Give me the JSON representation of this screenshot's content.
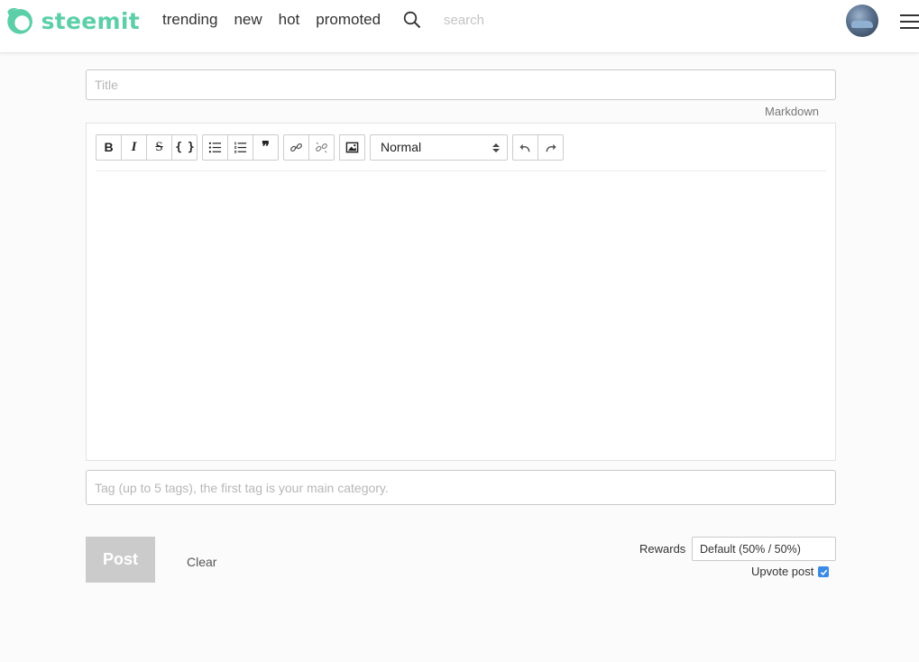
{
  "brand": {
    "name": "steemit",
    "color": "#5ccfa8"
  },
  "nav": {
    "items": [
      "trending",
      "new",
      "hot",
      "promoted"
    ]
  },
  "search": {
    "placeholder": "search"
  },
  "editor": {
    "title_placeholder": "Title",
    "markdown_link": "Markdown",
    "format_select": "Normal",
    "toolbar_icons": [
      "bold-icon",
      "italic-icon",
      "strikethrough-icon",
      "code-icon",
      "bullet-list-icon",
      "numbered-list-icon",
      "quote-icon",
      "link-icon",
      "unlink-icon",
      "image-icon",
      "undo-icon",
      "redo-icon"
    ],
    "bold_label": "B",
    "italic_label": "I",
    "strike_label": "S",
    "code_label": "{ }",
    "quote_label": "❞"
  },
  "tags": {
    "placeholder": "Tag (up to 5 tags), the first tag is your main category."
  },
  "actions": {
    "post_label": "Post",
    "clear_label": "Clear",
    "rewards_label": "Rewards",
    "rewards_value": "Default (50% / 50%)",
    "upvote_label": "Upvote post",
    "upvote_checked": true,
    "check_color": "#3b8ae8"
  }
}
